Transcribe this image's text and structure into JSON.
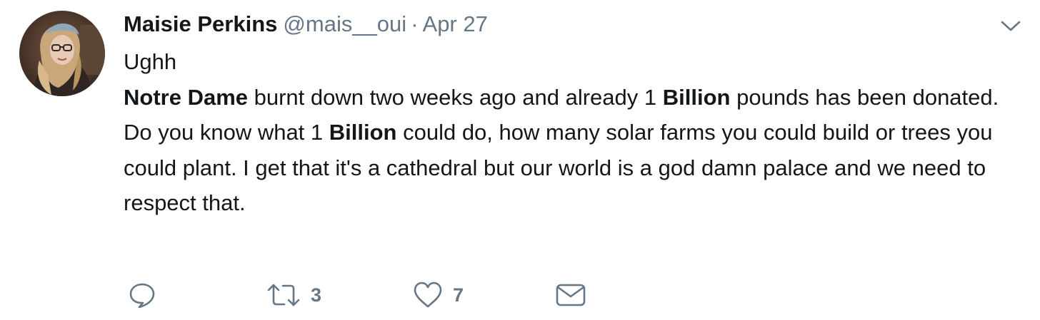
{
  "tweet": {
    "author_name": "Maisie Perkins",
    "handle": "@mais__oui",
    "separator": "·",
    "date": "Apr 27",
    "line1": "Ughh",
    "line2_bold1": "Notre Dame",
    "line2_text1": " burnt down two weeks ago and already 1 ",
    "line2_bold2": "Billion",
    "line2_text2": " pounds has been donated.",
    "line3_text1": "Do you know what 1 ",
    "line3_bold": "Billion",
    "line3_text2": " could do, how many solar farms you could build or trees you could plant. I get that it's a cathedral but our world is a god damn palace and we need to respect that."
  },
  "actions": {
    "reply_icon": "reply-icon",
    "retweet_icon": "retweet-icon",
    "retweet_count": "3",
    "like_icon": "heart-icon",
    "like_count": "7",
    "message_icon": "envelope-icon"
  },
  "colors": {
    "text": "#14171a",
    "secondary": "#657786"
  }
}
